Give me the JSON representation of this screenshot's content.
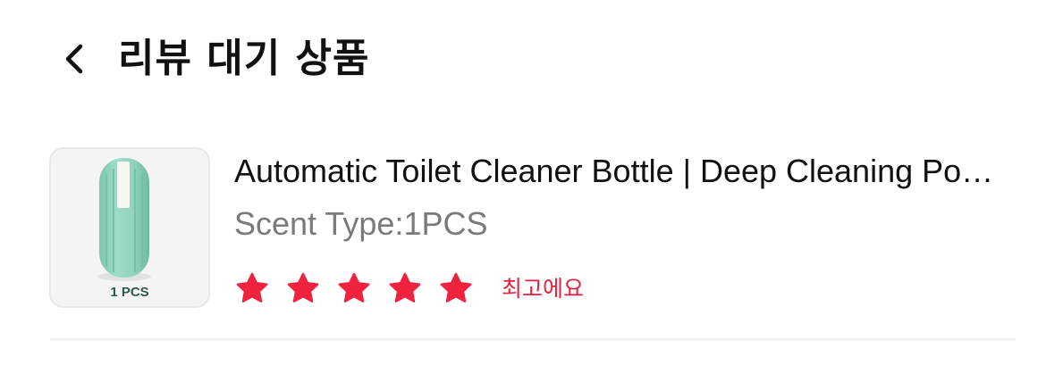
{
  "header": {
    "title": "리뷰 대기 상품"
  },
  "product": {
    "thumbnail_caption": "1 PCS",
    "title": "Automatic Toilet Cleaner Bottle | Deep Cleaning Pods",
    "option": "Scent Type:1PCS"
  },
  "rating": {
    "value": 5,
    "max": 5,
    "label": "최고에요",
    "star_color": "#F0233F",
    "label_color": "#E8203E"
  },
  "colors": {
    "product_bottle": "#8FD3BE",
    "divider": "#F1F1F1"
  },
  "icons": {
    "back": "chevron-left-icon",
    "star": "star-icon"
  }
}
